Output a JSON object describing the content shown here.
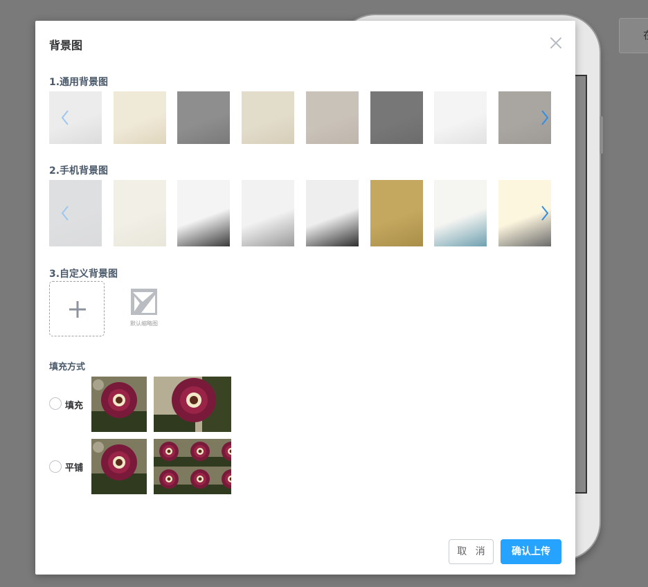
{
  "background": {
    "right_button_label": "在"
  },
  "dialog": {
    "title": "背景图",
    "close_icon": "close-icon",
    "sections": {
      "common": {
        "title": "1.通用背景图",
        "thumbnails": [
          {
            "name": "light-diamond-damask",
            "colors": [
              "#ececec",
              "#dcdcdc"
            ]
          },
          {
            "name": "cream-floral",
            "colors": [
              "#efe9d8",
              "#e0d6bd"
            ]
          },
          {
            "name": "grey-mottled",
            "colors": [
              "#8e8e8e",
              "#7a7a7a"
            ]
          },
          {
            "name": "beige-parchment",
            "colors": [
              "#e2dccb",
              "#d6ceb8"
            ]
          },
          {
            "name": "taupe-texture",
            "colors": [
              "#c9c2b9",
              "#bfb6ab"
            ]
          },
          {
            "name": "dark-grey-linen",
            "colors": [
              "#777777",
              "#6c6c6c"
            ]
          },
          {
            "name": "white-waves",
            "colors": [
              "#f4f4f4",
              "#e2e2e2"
            ]
          },
          {
            "name": "grey-concrete",
            "colors": [
              "#a9a6a2",
              "#9e9b97"
            ]
          }
        ],
        "prev_icon": "chevron-left-icon",
        "next_icon": "chevron-right-icon"
      },
      "mobile": {
        "title": "2.手机背景图",
        "thumbnails": [
          {
            "name": "plain-grey",
            "colors": [
              "#dedfe0",
              "#dadbdc"
            ]
          },
          {
            "name": "cream-paper",
            "colors": [
              "#f1efe6",
              "#e9e6da"
            ]
          },
          {
            "name": "ink-wash-boat",
            "colors": [
              "#f4f4f4",
              "#3a3a3a"
            ]
          },
          {
            "name": "misty-mountains",
            "colors": [
              "#f2f2f2",
              "#9a9a9a"
            ]
          },
          {
            "name": "ink-wall-house",
            "colors": [
              "#eeeeee",
              "#2e2e2e"
            ]
          },
          {
            "name": "gold-parchment",
            "colors": [
              "#c4a860",
              "#a88e47"
            ]
          },
          {
            "name": "round-window-landscape",
            "colors": [
              "#f5f5f2",
              "#6fa0b0"
            ]
          },
          {
            "name": "yellow-boat-birds",
            "colors": [
              "#fdf6df",
              "#6b6b6b"
            ]
          }
        ],
        "prev_icon": "chevron-left-icon",
        "next_icon": "chevron-right-icon"
      },
      "custom": {
        "title": "3.自定义背景图",
        "add_icon": "plus-icon",
        "default_thumb_icon": "broken-image-icon",
        "default_thumb_label": "默认缩略图"
      }
    },
    "fill_mode": {
      "title": "填充方式",
      "options": [
        {
          "label": "填充",
          "selected": false
        },
        {
          "label": "平铺",
          "selected": false
        }
      ]
    },
    "buttons": {
      "cancel": "取 消",
      "confirm": "确认上传"
    }
  }
}
